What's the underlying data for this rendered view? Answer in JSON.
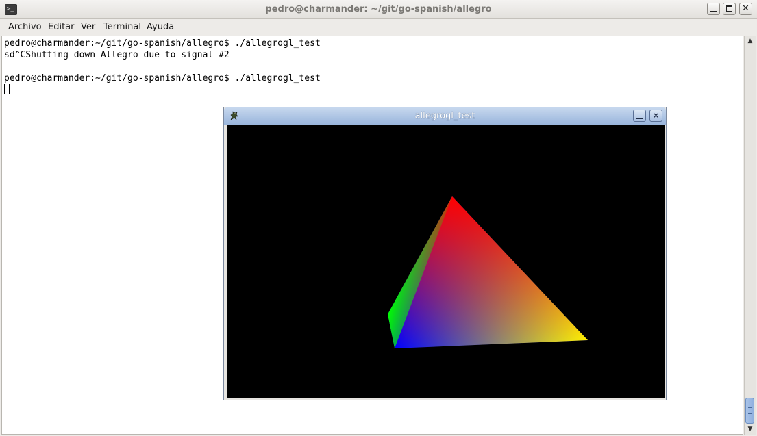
{
  "terminal": {
    "title": "pedro@charmander: ~/git/go-spanish/allegro",
    "app_icon": "terminal-icon",
    "menu": [
      {
        "label": "Archivo"
      },
      {
        "label": "Editar"
      },
      {
        "label": "Ver"
      },
      {
        "label": "Terminal"
      },
      {
        "label": "Ayuda"
      }
    ],
    "lines": [
      "pedro@charmander:~/git/go-spanish/allegro$ ./allegrogl_test",
      "sd^CShutting down Allegro due to signal #2",
      "",
      "pedro@charmander:~/git/go-spanish/allegro$ ./allegrogl_test"
    ]
  },
  "window_buttons": {
    "minimize": "minimize-icon",
    "maximize": "maximize-icon",
    "close": "close-icon",
    "close_glyph": "✕"
  },
  "scrollbar": {
    "up": "▲",
    "down": "▼"
  },
  "allegro": {
    "title": "allegrogl_test",
    "icon": "allegro-dragon-icon",
    "close_glyph": "✕",
    "triangle_colors": {
      "top": "#ff0000",
      "right": "#ffff00",
      "bottom_left": "#0000ff",
      "left": "#00ff00",
      "background": "#000000"
    }
  }
}
